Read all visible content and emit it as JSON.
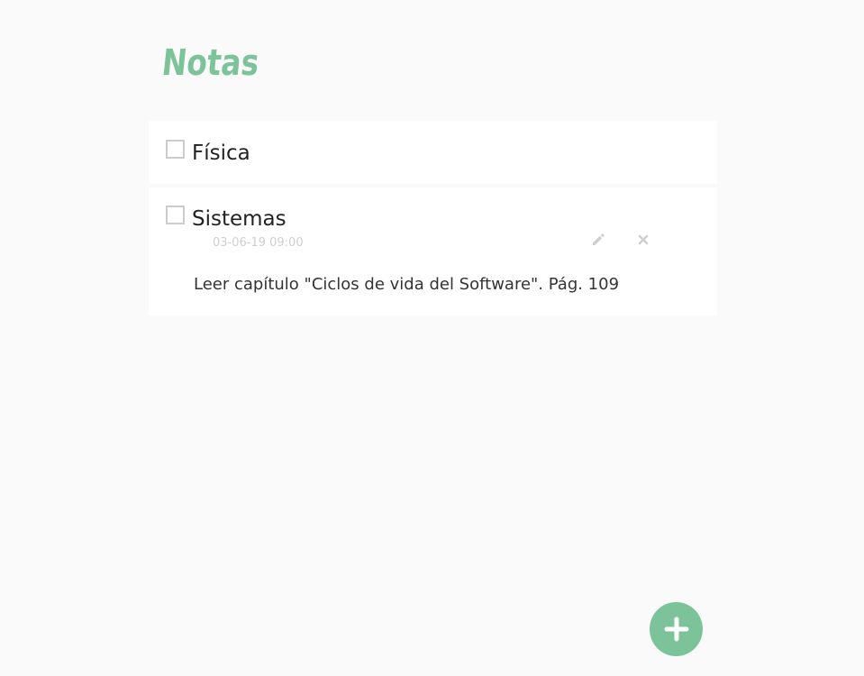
{
  "app": {
    "title": "Notas"
  },
  "notes": [
    {
      "title": "Física",
      "checked": false
    },
    {
      "title": "Sistemas",
      "checked": false,
      "date": "03-06-19 09:00",
      "body": "Leer capítulo \"Ciclos de vida del Software\". Pág. 109",
      "actions": [
        "pencil-icon",
        "close-icon"
      ]
    }
  ],
  "fab": {
    "icon": "plus-icon"
  },
  "colors": {
    "accent": "#7dc39a",
    "background": "#fafafa",
    "card": "#ffffff",
    "checkbox_border": "#cccccc",
    "muted_text": "#cfcfcf"
  }
}
